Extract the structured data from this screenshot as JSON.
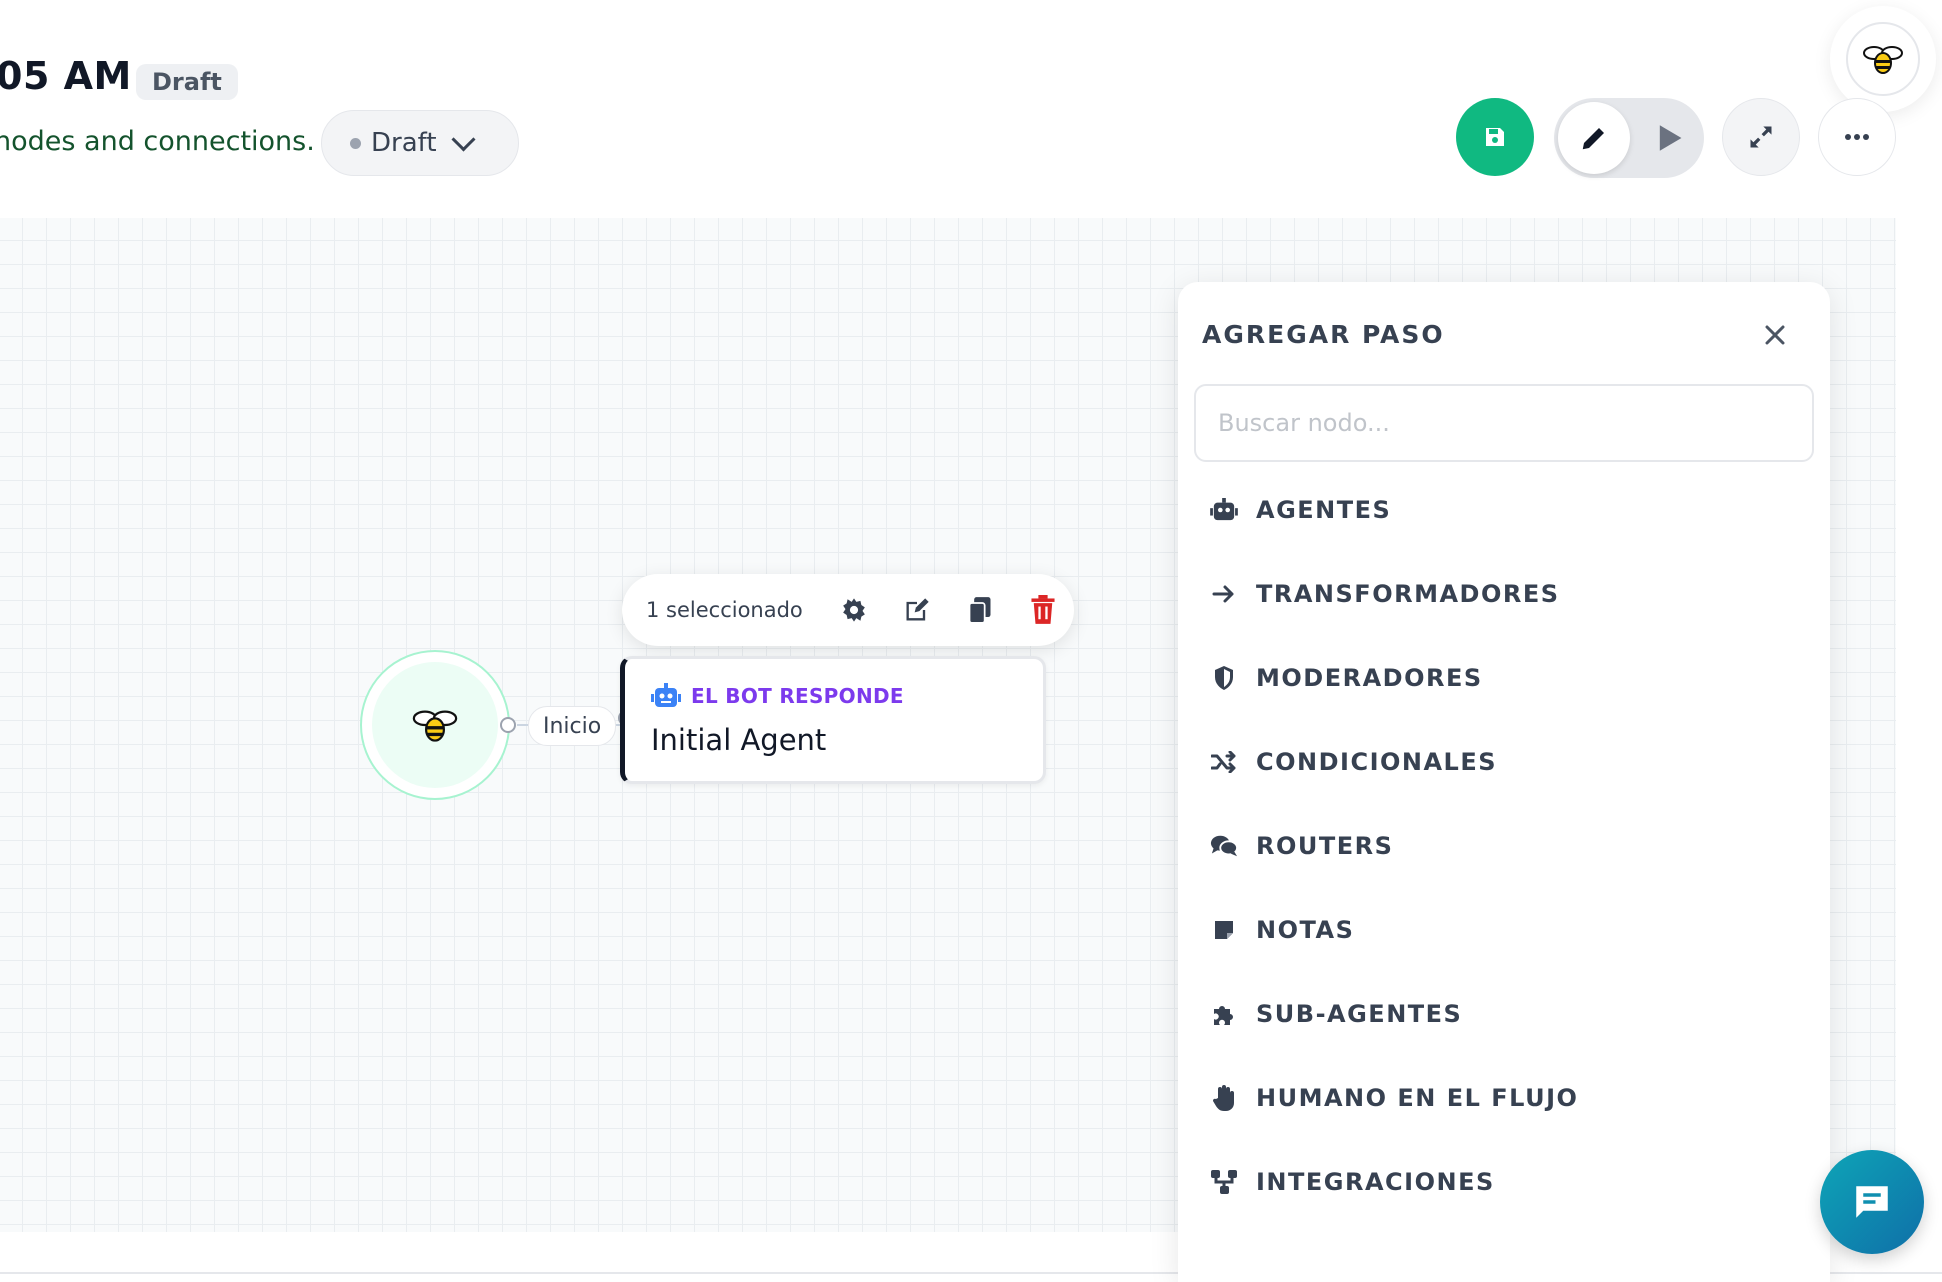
{
  "header": {
    "title": "05 AM",
    "title_badge": "Draft",
    "subtitle": "nodes and connections.",
    "status_select": {
      "value": "Draft"
    }
  },
  "toolbar": {
    "save_icon": "floppy-disk-icon",
    "edit_icon": "pencil-icon",
    "play_icon": "play-icon",
    "expand_icon": "expand-arrows-icon",
    "more_icon": "ellipsis-icon",
    "save_color": "#10b981"
  },
  "canvas": {
    "start_node": {
      "icon": "bee-icon"
    },
    "edge_label": "Inicio",
    "selection_toolbar": {
      "count_label": "1 seleccionado",
      "actions": [
        "settings",
        "edit",
        "duplicate",
        "delete"
      ]
    },
    "agent_node": {
      "type_label": "EL BOT RESPONDE",
      "name": "Initial Agent",
      "type_color": "#7c3aed"
    }
  },
  "panel": {
    "title": "AGREGAR PASO",
    "search_placeholder": "Buscar nodo...",
    "categories": [
      {
        "label": "AGENTES",
        "icon": "robot-icon"
      },
      {
        "label": "TRANSFORMADORES",
        "icon": "arrow-right-icon"
      },
      {
        "label": "MODERADORES",
        "icon": "shield-icon"
      },
      {
        "label": "CONDICIONALES",
        "icon": "shuffle-icon"
      },
      {
        "label": "ROUTERS",
        "icon": "comments-icon"
      },
      {
        "label": "NOTAS",
        "icon": "note-icon"
      },
      {
        "label": "SUB-AGENTES",
        "icon": "puzzle-icon"
      },
      {
        "label": "HUMANO EN EL FLUJO",
        "icon": "hand-icon"
      },
      {
        "label": "INTEGRACIONES",
        "icon": "nodes-icon"
      }
    ]
  },
  "chat_fab": {
    "icon": "chat-icon",
    "color": "#0f8fb0"
  }
}
